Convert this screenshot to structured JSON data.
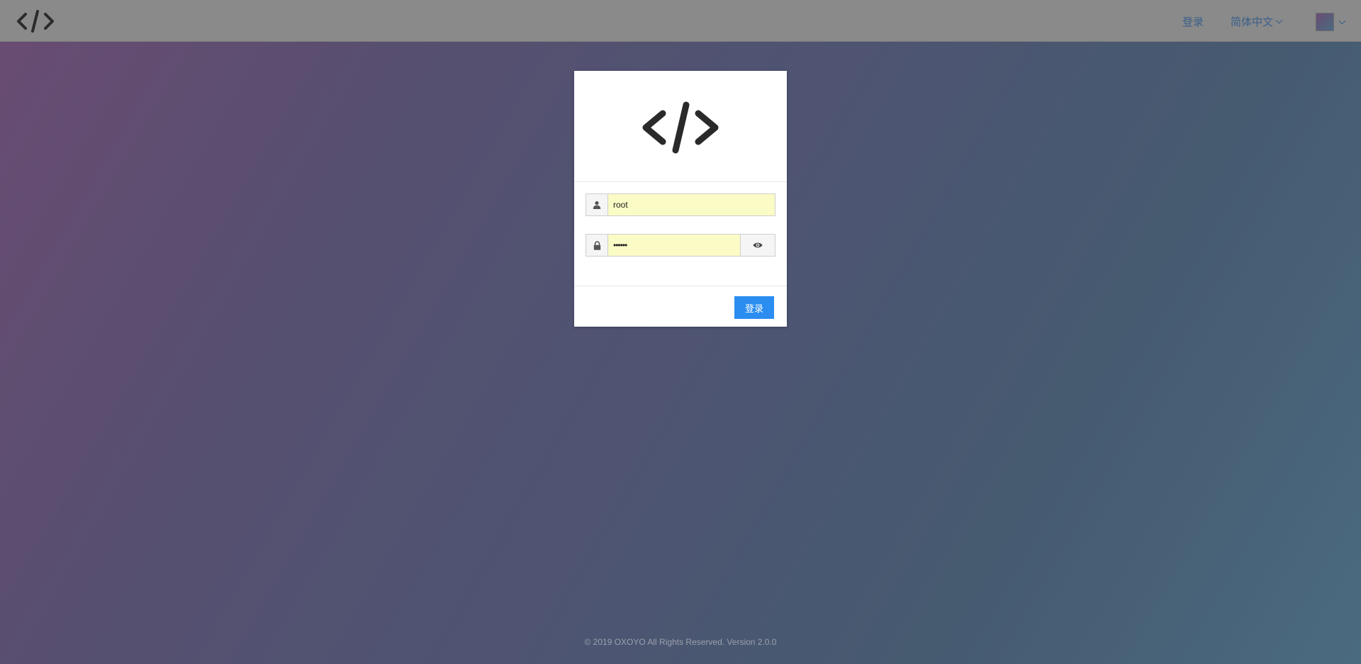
{
  "header": {
    "login_link": "登录",
    "language_selector": "简体中文",
    "logo_icon": "code-brackets-icon",
    "avatar_icon": "avatar"
  },
  "login_form": {
    "logo_icon": "code-brackets-icon",
    "username": {
      "value": "root",
      "icon": "user-icon"
    },
    "password": {
      "value": "••••••",
      "icon": "lock-icon",
      "toggle_icon": "eye-icon"
    },
    "submit_label": "登录"
  },
  "footer": {
    "text": "© 2019 OXOYO All Rights Reserved. Version 2.0.0"
  },
  "colors": {
    "primary": "#2b8df0",
    "autofill": "#fbfbc6",
    "nav_link": "#3a5f8a"
  }
}
